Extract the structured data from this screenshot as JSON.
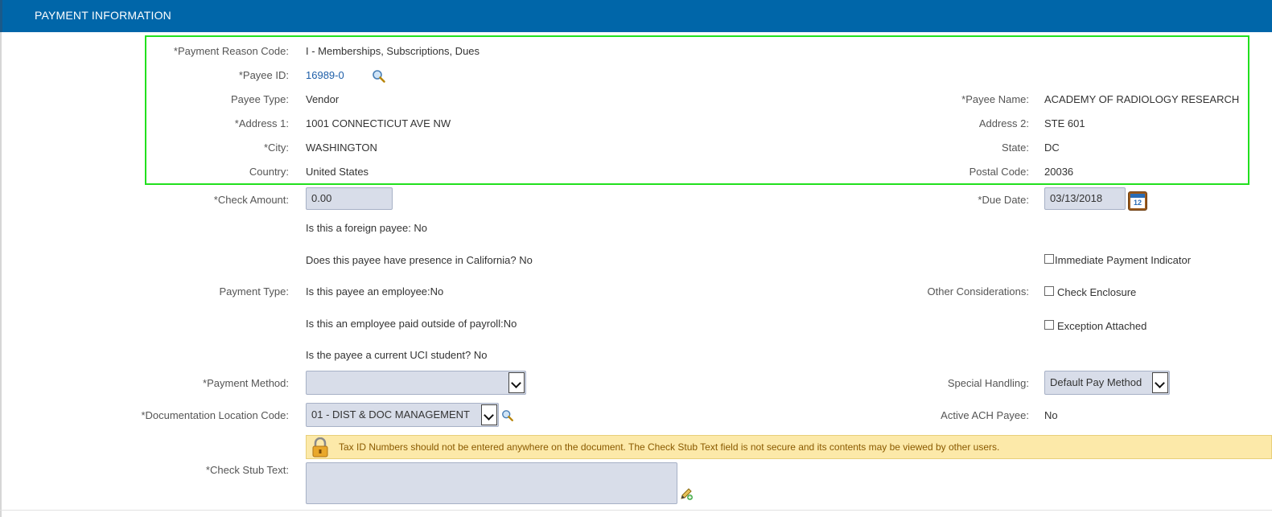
{
  "header": {
    "title": "PAYMENT INFORMATION"
  },
  "payee": {
    "payment_reason_code_label": "*Payment Reason Code:",
    "payment_reason_code": "I - Memberships, Subscriptions, Dues",
    "payee_id_label": "*Payee ID:",
    "payee_id": "16989-0",
    "payee_type_label": "Payee Type:",
    "payee_type": "Vendor",
    "payee_name_label": "*Payee Name:",
    "payee_name": "ACADEMY OF RADIOLOGY RESEARCH",
    "address1_label": "*Address 1:",
    "address1": "1001 CONNECTICUT AVE NW",
    "address2_label": "Address 2:",
    "address2": "STE 601",
    "city_label": "*City:",
    "city": "WASHINGTON",
    "state_label": "State:",
    "state": "DC",
    "country_label": "Country:",
    "country": "United States",
    "postal_code_label": "Postal Code:",
    "postal_code": "20036"
  },
  "payment": {
    "check_amount_label": "*Check Amount:",
    "check_amount": "0.00",
    "due_date_label": "*Due Date:",
    "due_date": "03/13/2018",
    "foreign_payee": "Is this a foreign payee: No",
    "california_presence": "Does this payee have presence in California?  No",
    "payment_type_label": "Payment Type:",
    "employee": "Is this payee an employee:No",
    "employee_outside_payroll": "Is this an employee paid outside of payroll:No",
    "uci_student": "Is the payee a current UCI student?  No",
    "other_considerations_label": "Other Considerations:",
    "immediate_payment": "Immediate Payment Indicator",
    "check_enclosure": "Check Enclosure",
    "exception_attached": "Exception Attached",
    "payment_method_label": "*Payment Method:",
    "payment_method": "",
    "special_handling_label": "Special Handling:",
    "special_handling": "Default Pay Method",
    "doc_location_label": "*Documentation Location Code:",
    "doc_location": "01 - DIST & DOC MANAGEMENT",
    "active_ach_label": "Active ACH Payee:",
    "active_ach": "No",
    "warning": "Tax ID Numbers should not be entered anywhere on the document. The Check Stub Text field is not secure and its contents may be viewed by other users.",
    "check_stub_label": "*Check Stub Text:",
    "check_stub_text": ""
  },
  "icons": {
    "lookup": "search-icon",
    "calendar": "calendar-icon",
    "lock": "lock-icon",
    "edit": "edit-pencil-icon"
  },
  "colors": {
    "header": "#0066a9",
    "highlight": "#22e01e",
    "warning_bg": "#fce9a9",
    "link": "#1d5ea8"
  }
}
